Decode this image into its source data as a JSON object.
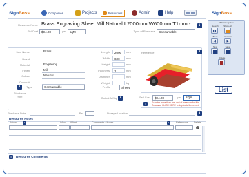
{
  "header": {
    "logo_text": "Sign",
    "logo_accent": "Boss",
    "nav": [
      {
        "label": "Companies",
        "icon": "companies-icon",
        "color": "#3b67b5"
      },
      {
        "label": "Projects",
        "icon": "projects-icon",
        "color": "#d4a017"
      },
      {
        "label": "Resources",
        "icon": "resources-icon",
        "color": "#e08a1a"
      },
      {
        "label": "Admin",
        "icon": "admin-icon",
        "color": "#8b2b2b"
      },
      {
        "label": "Help",
        "icon": "help-icon",
        "color": "#1f3f80"
      }
    ]
  },
  "resource": {
    "name_label": "Resource Name",
    "name_value": "Brass Engraving  Sheet Mill Natural L2000mm W600mm T1mm -",
    "std_cost_label": "Std Cost",
    "std_cost_value": "$94.00",
    "per_label": "per",
    "per_value": "sqM",
    "type_label": "Type of Resource",
    "type_value": "Consumable"
  },
  "details": {
    "fields": [
      {
        "label": "Item Name",
        "value": "Brass"
      },
      {
        "label": "Brand",
        "value": ""
      },
      {
        "label": "Material",
        "value": "Engraving"
      },
      {
        "label": "Finish",
        "value": "Mill"
      },
      {
        "label": "Colour",
        "value": "Natural"
      },
      {
        "label": "Colour #",
        "value": ""
      }
    ],
    "type_label": "Type",
    "type_value": "Consumable",
    "stock_label": "Stock size (mm)"
  },
  "dims": {
    "fields": [
      {
        "label": "Length",
        "value": "2000",
        "unit": "mm"
      },
      {
        "label": "Width",
        "value": "600",
        "unit": "mm"
      },
      {
        "label": "Height",
        "value": "",
        "unit": "mm"
      },
      {
        "label": "Thickness",
        "value": "1",
        "unit": "mm"
      },
      {
        "label": "Diameter",
        "value": "",
        "unit": "mm"
      },
      {
        "label": "Weight",
        "value": "",
        "unit": "kg"
      }
    ],
    "profile_label": "Profile",
    "profile_value": "Sheet",
    "output_label": "Output M/Sq"
  },
  "reference": {
    "label": "Reference"
  },
  "sell": {
    "cost_label": "Sell Cost",
    "cost_value": "$94.00",
    "per_label": "per",
    "per_value": "sqM",
    "note": "To order more than one unit of measure for this Resource CLICK HERE to duplicate the record"
  },
  "purchase": {
    "date_label": "Purchase Date",
    "ref_label": "Ref",
    "storage_label": "Storage Location"
  },
  "notes": {
    "title": "Resource Notes",
    "headers": [
      "When",
      "Who",
      "What",
      "Comments / Notes",
      "Reference",
      "Delete"
    ]
  },
  "comments": {
    "title": "Resource Comments"
  },
  "right_panel": {
    "logo_text": "Sign",
    "logo_accent": "Boss",
    "nav_title": "RBN Navigation",
    "search_label": "Search",
    "showall_label": "Show All",
    "back_label": "Back",
    "forward_label": "Forward",
    "new_label": "New",
    "save_label": "Save",
    "delete_label": "Delete",
    "list_label": "List"
  },
  "colors": {
    "accent": "#2f66b3",
    "navy": "#1f3f80",
    "orange": "#e07a1a"
  }
}
